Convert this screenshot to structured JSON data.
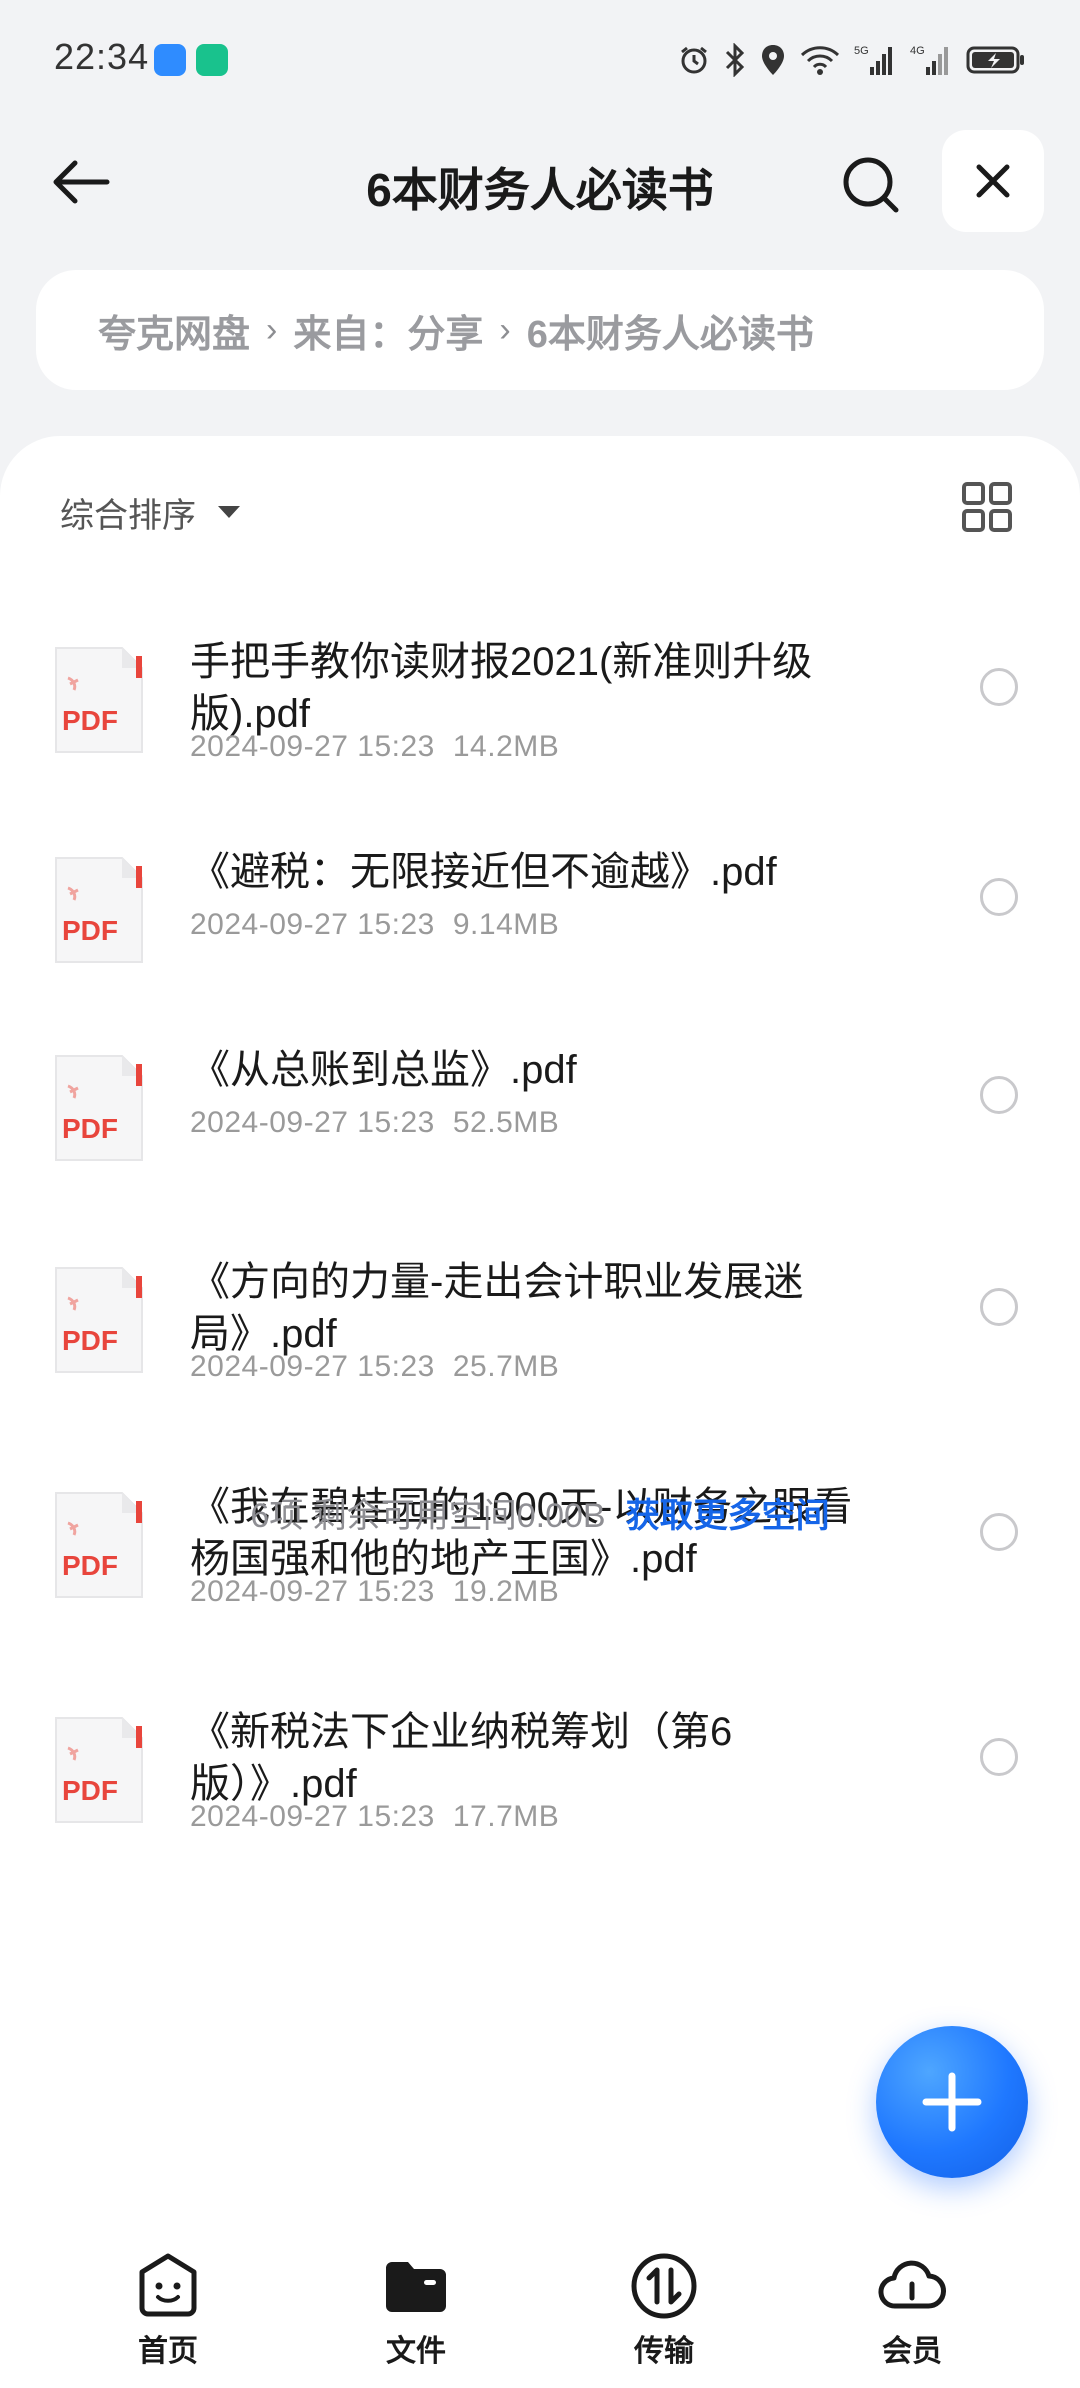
{
  "status_bar": {
    "time": "22:34",
    "icons": [
      "cloud-app-icon",
      "shield-app-icon",
      "alarm-icon",
      "bluetooth-icon",
      "location-icon",
      "wifi-icon",
      "signal-5g-icon",
      "signal-4g-icon",
      "battery-charging-icon"
    ],
    "network_5g": "5G",
    "network_4g": "4G"
  },
  "header": {
    "title": "6本财务人必读书",
    "back_icon": "arrow-left-icon",
    "search_icon": "search-icon",
    "close_icon": "close-icon"
  },
  "breadcrumb": {
    "items": [
      "夸克网盘",
      "来自：分享",
      "6本财务人必读书"
    ],
    "separator": "›"
  },
  "toolbar": {
    "sort_label": "综合排序",
    "view_toggle_icon": "grid-view-icon"
  },
  "files": [
    {
      "name": "手把手教你读财报2021(新准则升级版).pdf",
      "date": "2024-09-27 15:23",
      "size": "14.2MB",
      "type_label": "PDF"
    },
    {
      "name": "《避税：无限接近但不逾越》.pdf",
      "date": "2024-09-27 15:23",
      "size": "9.14MB",
      "type_label": "PDF"
    },
    {
      "name": "《从总账到总监》.pdf",
      "date": "2024-09-27 15:23",
      "size": "52.5MB",
      "type_label": "PDF"
    },
    {
      "name": "《方向的力量-走出会计职业发展迷局》.pdf",
      "date": "2024-09-27 15:23",
      "size": "25.7MB",
      "type_label": "PDF"
    },
    {
      "name": "《我在碧桂园的1000天-以财务之眼看 杨国强和他的地产王国》.pdf",
      "date": "2024-09-27 15:23",
      "size": "19.2MB",
      "type_label": "PDF"
    },
    {
      "name": "《新税法下企业纳税筹划（第6版）》.pdf",
      "date": "2024-09-27 15:23",
      "size": "17.7MB",
      "type_label": "PDF"
    }
  ],
  "summary": {
    "text": "6项 剩余可用空间0.00B",
    "link": "获取更多空间"
  },
  "fab": {
    "icon": "plus-icon"
  },
  "bottom_nav": [
    {
      "label": "首页",
      "icon": "smiley-home-icon"
    },
    {
      "label": "文件",
      "icon": "folder-icon"
    },
    {
      "label": "传输",
      "icon": "transfer-icon"
    },
    {
      "label": "会员",
      "icon": "cloud-member-icon"
    }
  ],
  "colors": {
    "accent": "#1f78ff",
    "link": "#1565e8",
    "pdf_red": "#e8453c",
    "background": "#f2f3f5"
  }
}
